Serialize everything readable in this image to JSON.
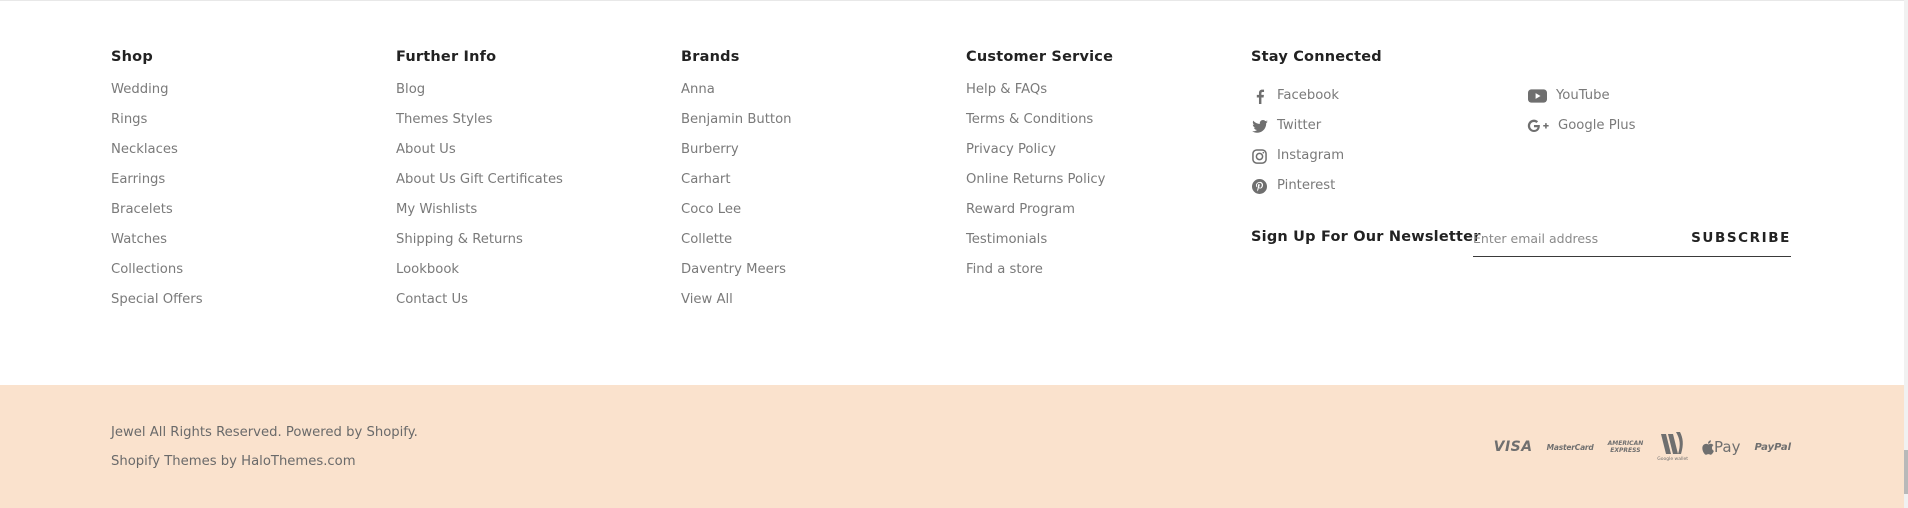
{
  "footer": {
    "shop": {
      "title": "Shop",
      "items": [
        "Wedding",
        "Rings",
        "Necklaces",
        "Earrings",
        "Bracelets",
        "Watches",
        "Collections",
        "Special Offers"
      ]
    },
    "further_info": {
      "title": "Further Info",
      "items": [
        "Blog",
        "Themes Styles",
        "About Us",
        "About Us Gift Certificates",
        "My Wishlists",
        "Shipping & Returns",
        "Lookbook",
        "Contact Us"
      ]
    },
    "brands": {
      "title": "Brands",
      "items": [
        "Anna",
        "Benjamin Button",
        "Burberry",
        "Carhart",
        "Coco Lee",
        "Collette",
        "Daventry Meers",
        "View All"
      ]
    },
    "customer_service": {
      "title": "Customer Service",
      "items": [
        "Help & FAQs",
        "Terms & Conditions",
        "Privacy Policy",
        "Online Returns Policy",
        "Reward Program",
        "Testimonials",
        "Find a store"
      ]
    },
    "stay_connected": {
      "title": "Stay Connected",
      "social_left": [
        {
          "label": "Facebook",
          "icon": "facebook-icon"
        },
        {
          "label": "Twitter",
          "icon": "twitter-icon"
        },
        {
          "label": "Instagram",
          "icon": "instagram-icon"
        },
        {
          "label": "Pinterest",
          "icon": "pinterest-icon"
        }
      ],
      "social_right": [
        {
          "label": "YouTube",
          "icon": "youtube-icon"
        },
        {
          "label": "Google Plus",
          "icon": "google-plus-icon"
        }
      ]
    },
    "newsletter": {
      "label": "Sign Up For Our Newsletter",
      "placeholder": "Enter email address",
      "button": "SUBSCRIBE"
    }
  },
  "bottom_bar": {
    "copyright": "Jewel All Rights Reserved. Powered by Shopify.",
    "credits": "Shopify Themes by HaloThemes.com",
    "payments": {
      "visa": "VISA",
      "mastercard": "MasterCard",
      "amex_top": "AMERICAN",
      "amex_bottom": "EXPRESS",
      "google_wallet": "Google wallet",
      "apple_pay": "Pay",
      "paypal": "PayPal"
    },
    "background_color": "#fae2cd"
  }
}
